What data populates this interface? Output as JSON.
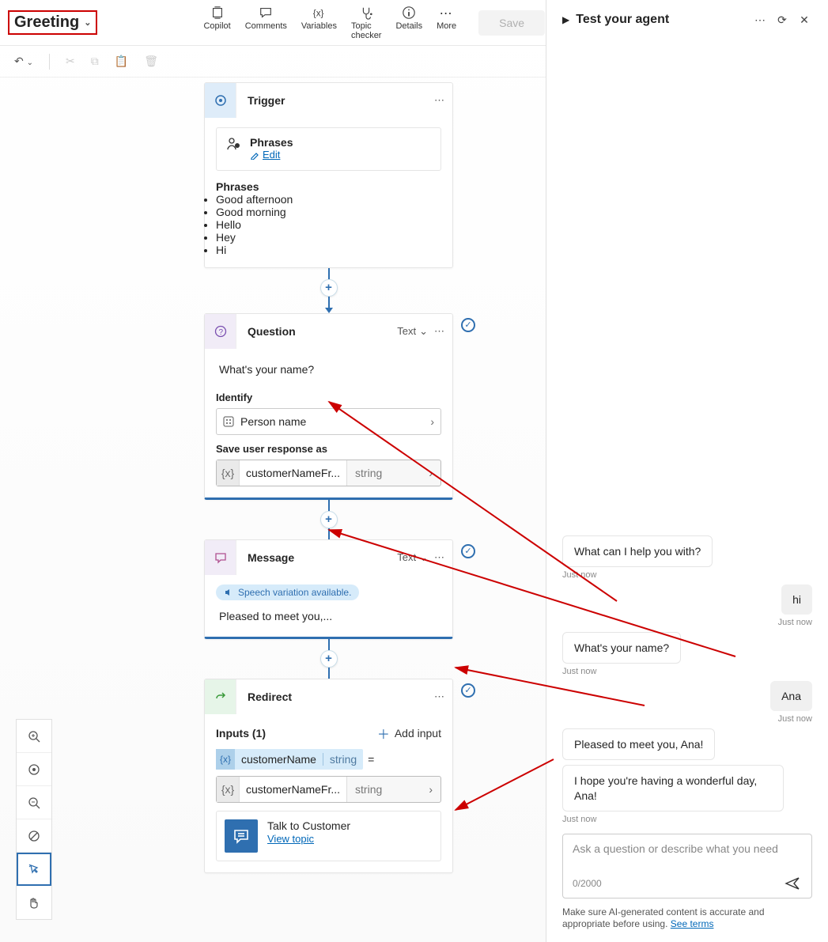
{
  "header": {
    "title": "Greeting",
    "items": {
      "copilot": "Copilot",
      "comments": "Comments",
      "variables": "Variables",
      "topic_checker": "Topic checker",
      "details": "Details",
      "more": "More"
    },
    "save": "Save"
  },
  "trigger": {
    "title": "Trigger",
    "phrases_label": "Phrases",
    "edit": "Edit",
    "list_title": "Phrases",
    "phrases": [
      "Good afternoon",
      "Good morning",
      "Hello",
      "Hey",
      "Hi"
    ]
  },
  "question": {
    "title": "Question",
    "text_label": "Text",
    "prompt": "What's your name?",
    "identify_label": "Identify",
    "identify_value": "Person name",
    "save_as_label": "Save user response as",
    "var_name": "customerNameFr...",
    "var_type": "string"
  },
  "message": {
    "title": "Message",
    "text_label": "Text",
    "chip": "Speech variation available.",
    "body": "Pleased to meet you,..."
  },
  "redirect": {
    "title": "Redirect",
    "inputs_label": "Inputs (1)",
    "add_input": "Add input",
    "in_name": "customerName",
    "in_type": "string",
    "eq": "=",
    "out_name": "customerNameFr...",
    "out_type": "string",
    "talk_title": "Talk to Customer",
    "view_topic": "View topic"
  },
  "test": {
    "title": "Test your agent",
    "just_now": "Just now",
    "messages": {
      "m1": "What can I help you with?",
      "m2": "hi",
      "m3": "What's your name?",
      "m4": "Ana",
      "m5": "Pleased to meet you, Ana!",
      "m6": "I hope you're having a wonderful day, Ana!"
    },
    "composer_ph": "Ask a question or describe what you need",
    "counter": "0/2000",
    "disclaimer_a": "Make sure AI-generated content is accurate and appropriate before using. ",
    "disclaimer_link": "See terms"
  }
}
